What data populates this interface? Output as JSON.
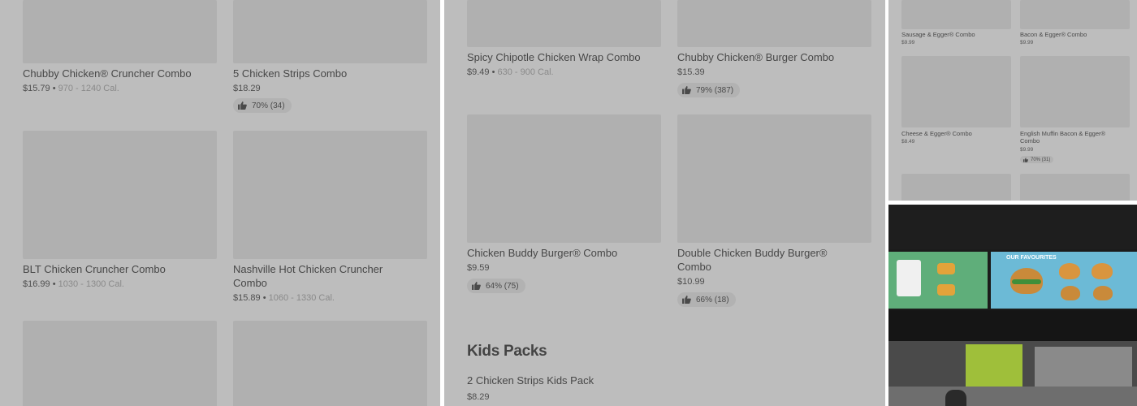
{
  "left": {
    "items": [
      {
        "name": "Chubby Chicken® Cruncher Combo",
        "price": "$15.79",
        "cal": "970 - 1240 Cal."
      },
      {
        "name": "5 Chicken Strips Combo",
        "price": "$18.29",
        "rating": "70% (34)"
      },
      {
        "name": "BLT Chicken Cruncher Combo",
        "price": "$16.99",
        "cal": "1030 - 1300 Cal."
      },
      {
        "name_line1": "Nashville Hot Chicken Cruncher",
        "name_line2": "Combo",
        "price": "$15.89",
        "cal": "1060 - 1330 Cal."
      }
    ]
  },
  "middle": {
    "items": [
      {
        "name": "Spicy Chipotle Chicken Wrap Combo",
        "price": "$9.49",
        "cal": "630 - 900 Cal."
      },
      {
        "name": "Chubby Chicken® Burger Combo",
        "price": "$15.39",
        "rating": "79% (387)"
      },
      {
        "name": "Chicken Buddy Burger® Combo",
        "price": "$9.59",
        "rating": "64% (75)"
      },
      {
        "name_line1": "Double Chicken Buddy Burger®",
        "name_line2": "Combo",
        "price": "$10.99",
        "rating": "66% (18)"
      }
    ],
    "section_title": "Kids Packs",
    "kids_item": {
      "name": "2 Chicken Strips Kids Pack",
      "price": "$8.29"
    }
  },
  "right": {
    "items": [
      {
        "name": "Sausage & Egger® Combo",
        "price": "$9.99"
      },
      {
        "name": "Bacon & Egger® Combo",
        "price": "$9.99"
      },
      {
        "name": "Cheese & Egger® Combo",
        "price": "$8.49"
      },
      {
        "name": "English Muffin Bacon & Egger® Combo",
        "price": "$9.99",
        "rating": "70% (31)"
      }
    ]
  },
  "photo": {
    "board_title": "OUR FAVOURITES"
  },
  "icons": {
    "rating": "thumbs-up-icon"
  },
  "colors": {
    "overlay": "#bdbdbd",
    "placeholder": "#b0b0b0",
    "pill": "#b2b2b2"
  }
}
